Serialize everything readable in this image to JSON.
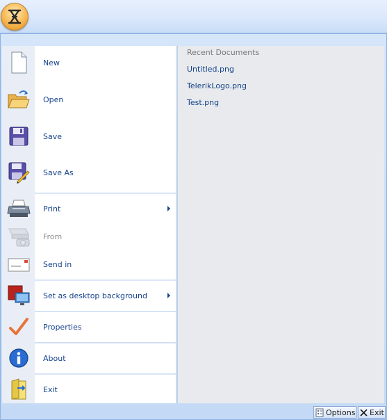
{
  "app_button": {
    "icon": "app-menu-icon",
    "accent": "#f8b850"
  },
  "menu": {
    "items": [
      {
        "label": "New",
        "icon": "new-document-icon"
      },
      {
        "label": "Open",
        "icon": "open-folder-icon"
      },
      {
        "label": "Save",
        "icon": "save-disk-icon"
      },
      {
        "label": "Save As",
        "icon": "save-as-icon"
      },
      {
        "label": "Print",
        "icon": "printer-icon"
      },
      {
        "label": "From",
        "icon": "scanner-camera-icon"
      },
      {
        "label": "Send in",
        "icon": "envelope-icon"
      },
      {
        "label": "Set as desktop background",
        "icon": "desktop-background-icon"
      },
      {
        "label": "Properties",
        "icon": "checkmark-icon"
      },
      {
        "label": "About",
        "icon": "info-icon"
      },
      {
        "label": "Exit",
        "icon": "exit-icon"
      }
    ]
  },
  "recent": {
    "title": "Recent Documents",
    "items": [
      "Untitled.png",
      "TelerikLogo.png",
      "Test.png"
    ]
  },
  "footer": {
    "options_label": "Options",
    "exit_label": "Exit"
  },
  "colors": {
    "text": "#15428b",
    "disabled_text": "#8d8d8d",
    "frame": "#bfdbff"
  }
}
